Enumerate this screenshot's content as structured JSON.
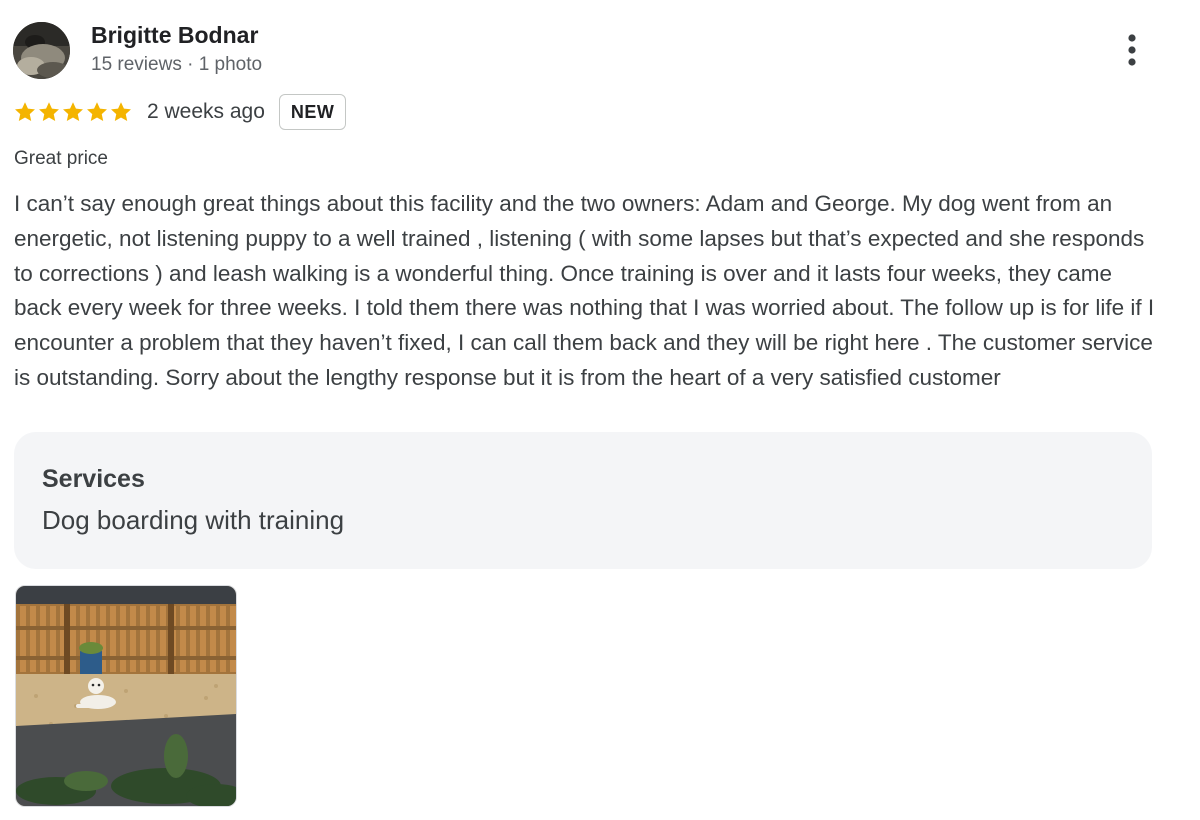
{
  "review": {
    "author": {
      "name": "Brigitte Bodnar",
      "meta": "15 reviews · 1 photo"
    },
    "rating": {
      "stars": 5,
      "max": 5,
      "color": "#f4b400"
    },
    "time_ago": "2 weeks ago",
    "badge": "NEW",
    "tag": "Great price",
    "body": "I can’t say enough great things about this facility and the two owners: Adam and George. My dog went from an energetic, not listening puppy to a well trained , listening ( with some lapses but that’s expected and she responds to corrections ) and leash walking is a wonderful thing. Once training is over and it lasts four weeks, they came back every week for three weeks. I told them there was nothing that I was worried about. The follow up is for life if I encounter a problem that they haven’t fixed, I can call them back and they will be right here . The customer service is outstanding. Sorry about the lengthy response but it is from the heart of a very satisfied customer",
    "services": {
      "title": "Services",
      "value": "Dog boarding with training"
    },
    "photo": {
      "icon": "review-photo"
    },
    "menu_icon": "more-vert-icon"
  }
}
